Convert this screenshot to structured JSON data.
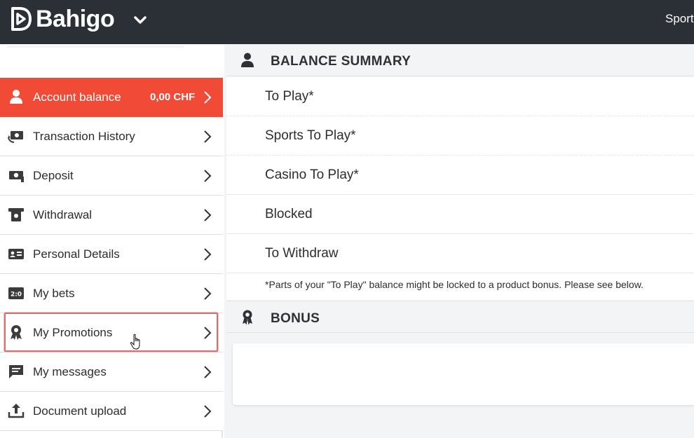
{
  "header": {
    "brand_name": "Bahigo",
    "nav_item": "Sport"
  },
  "colors": {
    "header_bg": "#2b2f36",
    "accent": "#f14a36",
    "highlight_border": "#e06b6b",
    "main_bg": "#f3f4f6"
  },
  "sidebar": {
    "items": [
      {
        "label": "Account balance",
        "amount": "0,00 CHF",
        "icon": "user-icon",
        "active": true
      },
      {
        "label": "Transaction History",
        "icon": "money-history-icon"
      },
      {
        "label": "Deposit",
        "icon": "money-deposit-icon"
      },
      {
        "label": "Withdrawal",
        "icon": "atm-withdrawal-icon"
      },
      {
        "label": "Personal Details",
        "icon": "id-card-icon"
      },
      {
        "label": "My bets",
        "icon": "scoreboard-icon"
      },
      {
        "label": "My Promotions",
        "icon": "award-ribbon-icon",
        "highlighted": true
      },
      {
        "label": "My messages",
        "icon": "chat-bubble-icon"
      },
      {
        "label": "Document upload",
        "icon": "upload-icon"
      }
    ]
  },
  "balance_summary": {
    "title": "BALANCE SUMMARY",
    "icon": "user-icon",
    "rows": [
      {
        "label": "To Play*"
      },
      {
        "label": "Sports To Play*"
      },
      {
        "label": "Casino To Play*"
      },
      {
        "label": "Blocked"
      },
      {
        "label": "To Withdraw"
      }
    ],
    "note": "*Parts of your \"To Play\" balance might be locked to a product bonus. Please see below."
  },
  "bonus": {
    "title": "BONUS",
    "icon": "award-ribbon-icon"
  }
}
